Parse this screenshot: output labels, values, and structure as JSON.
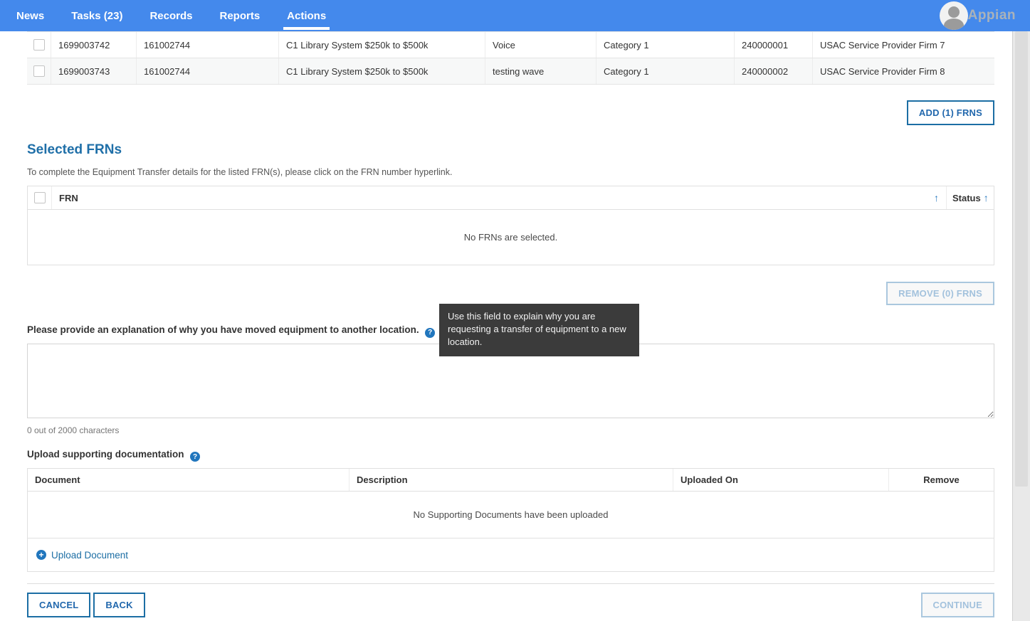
{
  "nav": {
    "items": [
      {
        "label": "News"
      },
      {
        "label": "Tasks (23)"
      },
      {
        "label": "Records"
      },
      {
        "label": "Reports"
      },
      {
        "label": "Actions"
      }
    ],
    "active": "Actions",
    "brand": "Appian"
  },
  "pool": {
    "rows": [
      [
        "1699003742",
        "161002744",
        "C1 Library System $250k to $500k",
        "Voice",
        "Category 1",
        "240000001",
        "USAC Service Provider Firm 7"
      ],
      [
        "1699003743",
        "161002744",
        "C1 Library System $250k to $500k",
        "testing wave",
        "Category 1",
        "240000002",
        "USAC Service Provider Firm 8"
      ]
    ],
    "add_button": "ADD (1) FRNS"
  },
  "selected": {
    "title": "Selected FRNs",
    "subtitle": "To complete the Equipment Transfer details for the listed FRN(s), please click on the FRN number hyperlink.",
    "frn_header": "FRN",
    "status_header": "Status",
    "sort_arrow": "↑",
    "empty_message": "No FRNs are selected.",
    "remove_button": "REMOVE (0) FRNS"
  },
  "explanation": {
    "label": "Please provide an explanation of why you have moved equipment to another location.",
    "help_glyph": "?",
    "tooltip": "Use this field to explain why you are requesting a transfer of equipment to a new location.",
    "value": "",
    "char_count": "0 out of 2000 characters"
  },
  "upload": {
    "label": "Upload supporting documentation",
    "help_glyph": "?",
    "columns": [
      "Document",
      "Description",
      "Uploaded On",
      "Remove"
    ],
    "empty_message": "No Supporting Documents have been uploaded",
    "link_label": "Upload Document",
    "plus_glyph": "+"
  },
  "footer": {
    "cancel": "CANCEL",
    "back": "BACK",
    "continue": "CONTINUE"
  },
  "colors": {
    "nav_blue": "#4489ec",
    "heading_blue": "#1f6fa8",
    "button_blue": "#1c6ea4",
    "disabled_blue": "#a3c2dd",
    "tooltip_bg": "#3b3b3b"
  }
}
